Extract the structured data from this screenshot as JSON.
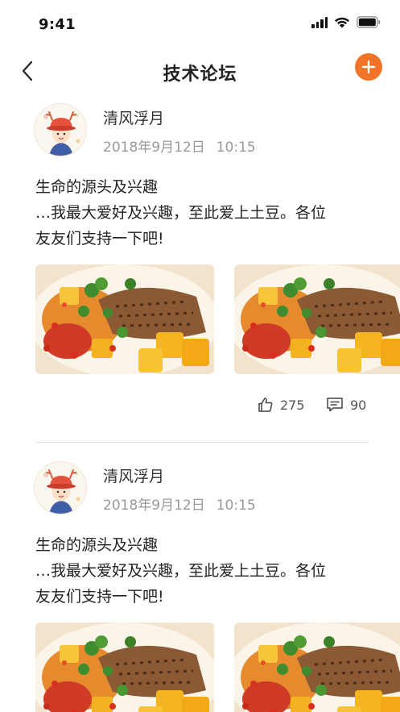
{
  "status_bar": {
    "time": "9:41"
  },
  "nav": {
    "title": "技术论坛"
  },
  "posts": [
    {
      "author": "清风浮月",
      "date": "2018年9月12日",
      "time": "10:15",
      "content_lines": [
        "生命的源头及兴趣",
        "…我最大爱好及兴趣，至此爱上土豆。各位",
        "友友们支持一下吧!"
      ],
      "likes": "275",
      "comments": "90"
    },
    {
      "author": "清风浮月",
      "date": "2018年9月12日",
      "time": "10:15",
      "content_lines": [
        "生命的源头及兴趣",
        "…我最大爱好及兴趣，至此爱上土豆。各位",
        "友友们支持一下吧!"
      ]
    }
  ],
  "colors": {
    "accent": "#f07428",
    "divider": "#e3e3e3",
    "secondary_text": "#999999"
  },
  "icons": [
    "signal-icon",
    "wifi-icon",
    "battery-icon",
    "back-chevron-icon",
    "plus-icon",
    "thumbs-up-icon",
    "comment-icon"
  ]
}
